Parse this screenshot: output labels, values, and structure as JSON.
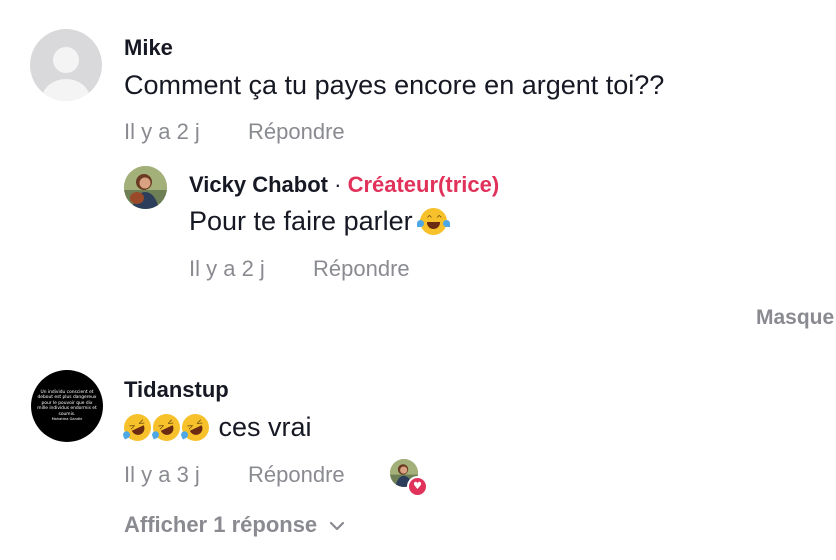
{
  "comments": [
    {
      "username": "Mike",
      "text": "Comment ça tu payes encore en argent toi??",
      "time": "Il y a 2 j",
      "reply_label": "Répondre",
      "avatar_icon": "default-user-avatar",
      "replies": [
        {
          "username": "Vicky Chabot",
          "separator": "·",
          "badge": "Créateur(trice)",
          "text": "Pour te faire parler",
          "emoji": "face-with-tears-of-joy",
          "time": "Il y a 2 j",
          "reply_label": "Répondre"
        }
      ],
      "hide_label": "Masque"
    },
    {
      "username": "Tidanstup",
      "emojis": [
        "rolling-on-floor-laughing",
        "rolling-on-floor-laughing",
        "rolling-on-floor-laughing"
      ],
      "text": "ces vrai",
      "time": "Il y a 3 j",
      "reply_label": "Répondre",
      "avatar_text": "Un individu conscient et debout est plus dangereux pour le pouvoir que dix mille individus endormis et soumis.",
      "avatar_signature": "Mahatma Gandhi",
      "creator_liked": true,
      "show_replies_label": "Afficher 1 réponse"
    }
  ],
  "colors": {
    "text": "#161823",
    "meta": "#8a8b91",
    "creator_badge": "#e0325a",
    "emoji_yellow": "#f7c12b"
  }
}
